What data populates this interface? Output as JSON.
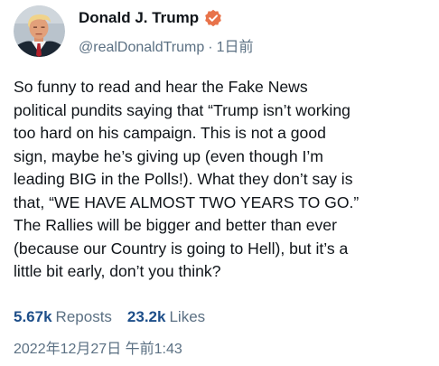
{
  "author": {
    "display_name": "Donald J. Trump",
    "handle": "@realDonaldTrump",
    "separator": "·",
    "time_ago": "1日前",
    "avatar_icon": "profile-photo",
    "verified_icon": "verified-badge-icon"
  },
  "post": {
    "text": "So funny to read and hear the Fake News\npolitical pundits saying that “Trump isn’t working\ntoo hard on his campaign. This is not a good\nsign, maybe he’s giving up (even though I’m\nleading BIG in the Polls!). What they don’t say is\nthat, “WE HAVE ALMOST TWO YEARS TO GO.”\nThe Rallies will be bigger and better than ever\n(because our Country is going to Hell), but it’s a\nlittle bit early, don’t you think?"
  },
  "stats": {
    "reposts_count": "5.67k",
    "reposts_label": "Reposts",
    "likes_count": "23.2k",
    "likes_label": "Likes"
  },
  "timestamp": "2022年12月27日 午前1:43",
  "colors": {
    "verified_badge": "#e8734a",
    "stat_number": "#1d4e89",
    "secondary_text": "#5b7083"
  }
}
